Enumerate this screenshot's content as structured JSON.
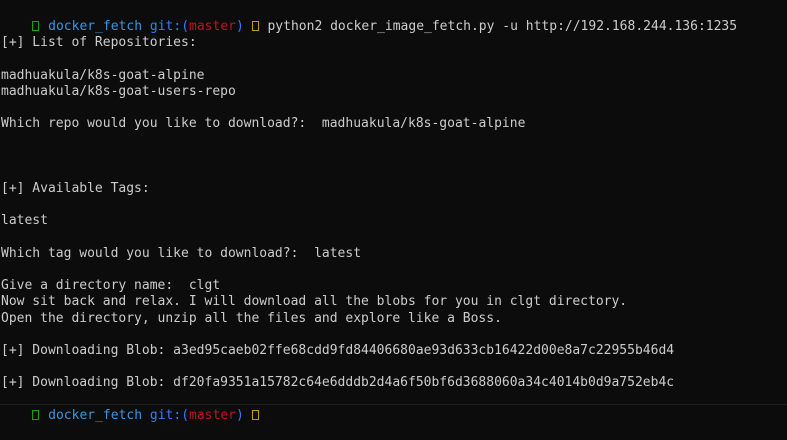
{
  "prompt_1": {
    "status_glyph": "arrow-icon",
    "dir": "docker_fetch",
    "git_label": "git:(",
    "branch": "master",
    "git_close": ")",
    "dirty_glyph": "dirty-marker-icon",
    "command": "python2 docker_image_fetch.py -u http://192.168.244.136:1235"
  },
  "output": {
    "repos_header": "[+] List of Repositories:",
    "repos": [
      "madhuakula/k8s-goat-alpine",
      "madhuakula/k8s-goat-users-repo"
    ],
    "repo_question": "Which repo would you like to download?:",
    "repo_answer": "madhuakula/k8s-goat-alpine",
    "tags_header": "[+] Available Tags:",
    "tags": [
      "latest"
    ],
    "tag_question": "Which tag would you like to download?:",
    "tag_answer": "latest",
    "dir_question": "Give a directory name:",
    "dir_answer": "clgt",
    "relax_msg": "Now sit back and relax. I will download all the blobs for you in clgt directory.",
    "open_msg": "Open the directory, unzip all the files and explore like a Boss.",
    "blob_1": "[+] Downloading Blob: a3ed95caeb02ffe68cdd9fd84406680ae93d633cb16422d00e8a7c22955b46d4",
    "blob_2": "[+] Downloading Blob: df20fa9351a15782c64e6dddb2d4a6f50bf6d3688060a34c4014b0d9a752eb4c"
  },
  "prompt_2": {
    "status_glyph": "arrow-icon",
    "dir": "docker_fetch",
    "git_label": "git:(",
    "branch": "master",
    "git_close": ")",
    "dirty_glyph": "dirty-marker-icon"
  },
  "colors": {
    "background": "#0c0c0c",
    "foreground": "#cccccc",
    "prompt_ok": "#13a10e",
    "dir": "#3a96dd",
    "git": "#3b78ff",
    "branch": "#c50f1f",
    "dirty": "#c19c00"
  }
}
